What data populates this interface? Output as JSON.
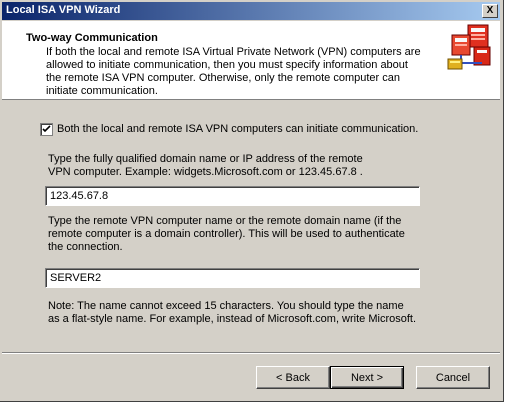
{
  "window": {
    "title": "Local ISA VPN Wizard",
    "close_label": "X"
  },
  "header": {
    "title": "Two-way Communication",
    "description": "If both the local and remote ISA Virtual Private Network (VPN) computers are allowed to initiate communication, then you must specify information about the remote ISA VPN computer. Otherwise, only the remote computer can initiate communication.",
    "icon": "network-computers-icon"
  },
  "options": {
    "both_initiate_label": "Both the local and remote ISA VPN computers can initiate communication.",
    "both_initiate_checked": true
  },
  "address": {
    "instructions": "Type the fully qualified domain name or IP address of the remote VPN computer. Example: widgets.Microsoft.com or 123.45.67.8 .",
    "value": "123.45.67.8"
  },
  "remote_name": {
    "instructions": "Type the remote VPN computer name or the remote domain name (if the remote computer is a domain controller). This will be used to authenticate the connection.",
    "value": "SERVER2"
  },
  "note": "Note: The name cannot exceed 15 characters. You should type the name as a flat-style name. For example, instead of Microsoft.com, write Microsoft.",
  "buttons": {
    "back": "< Back",
    "next": "Next >",
    "cancel": "Cancel"
  }
}
